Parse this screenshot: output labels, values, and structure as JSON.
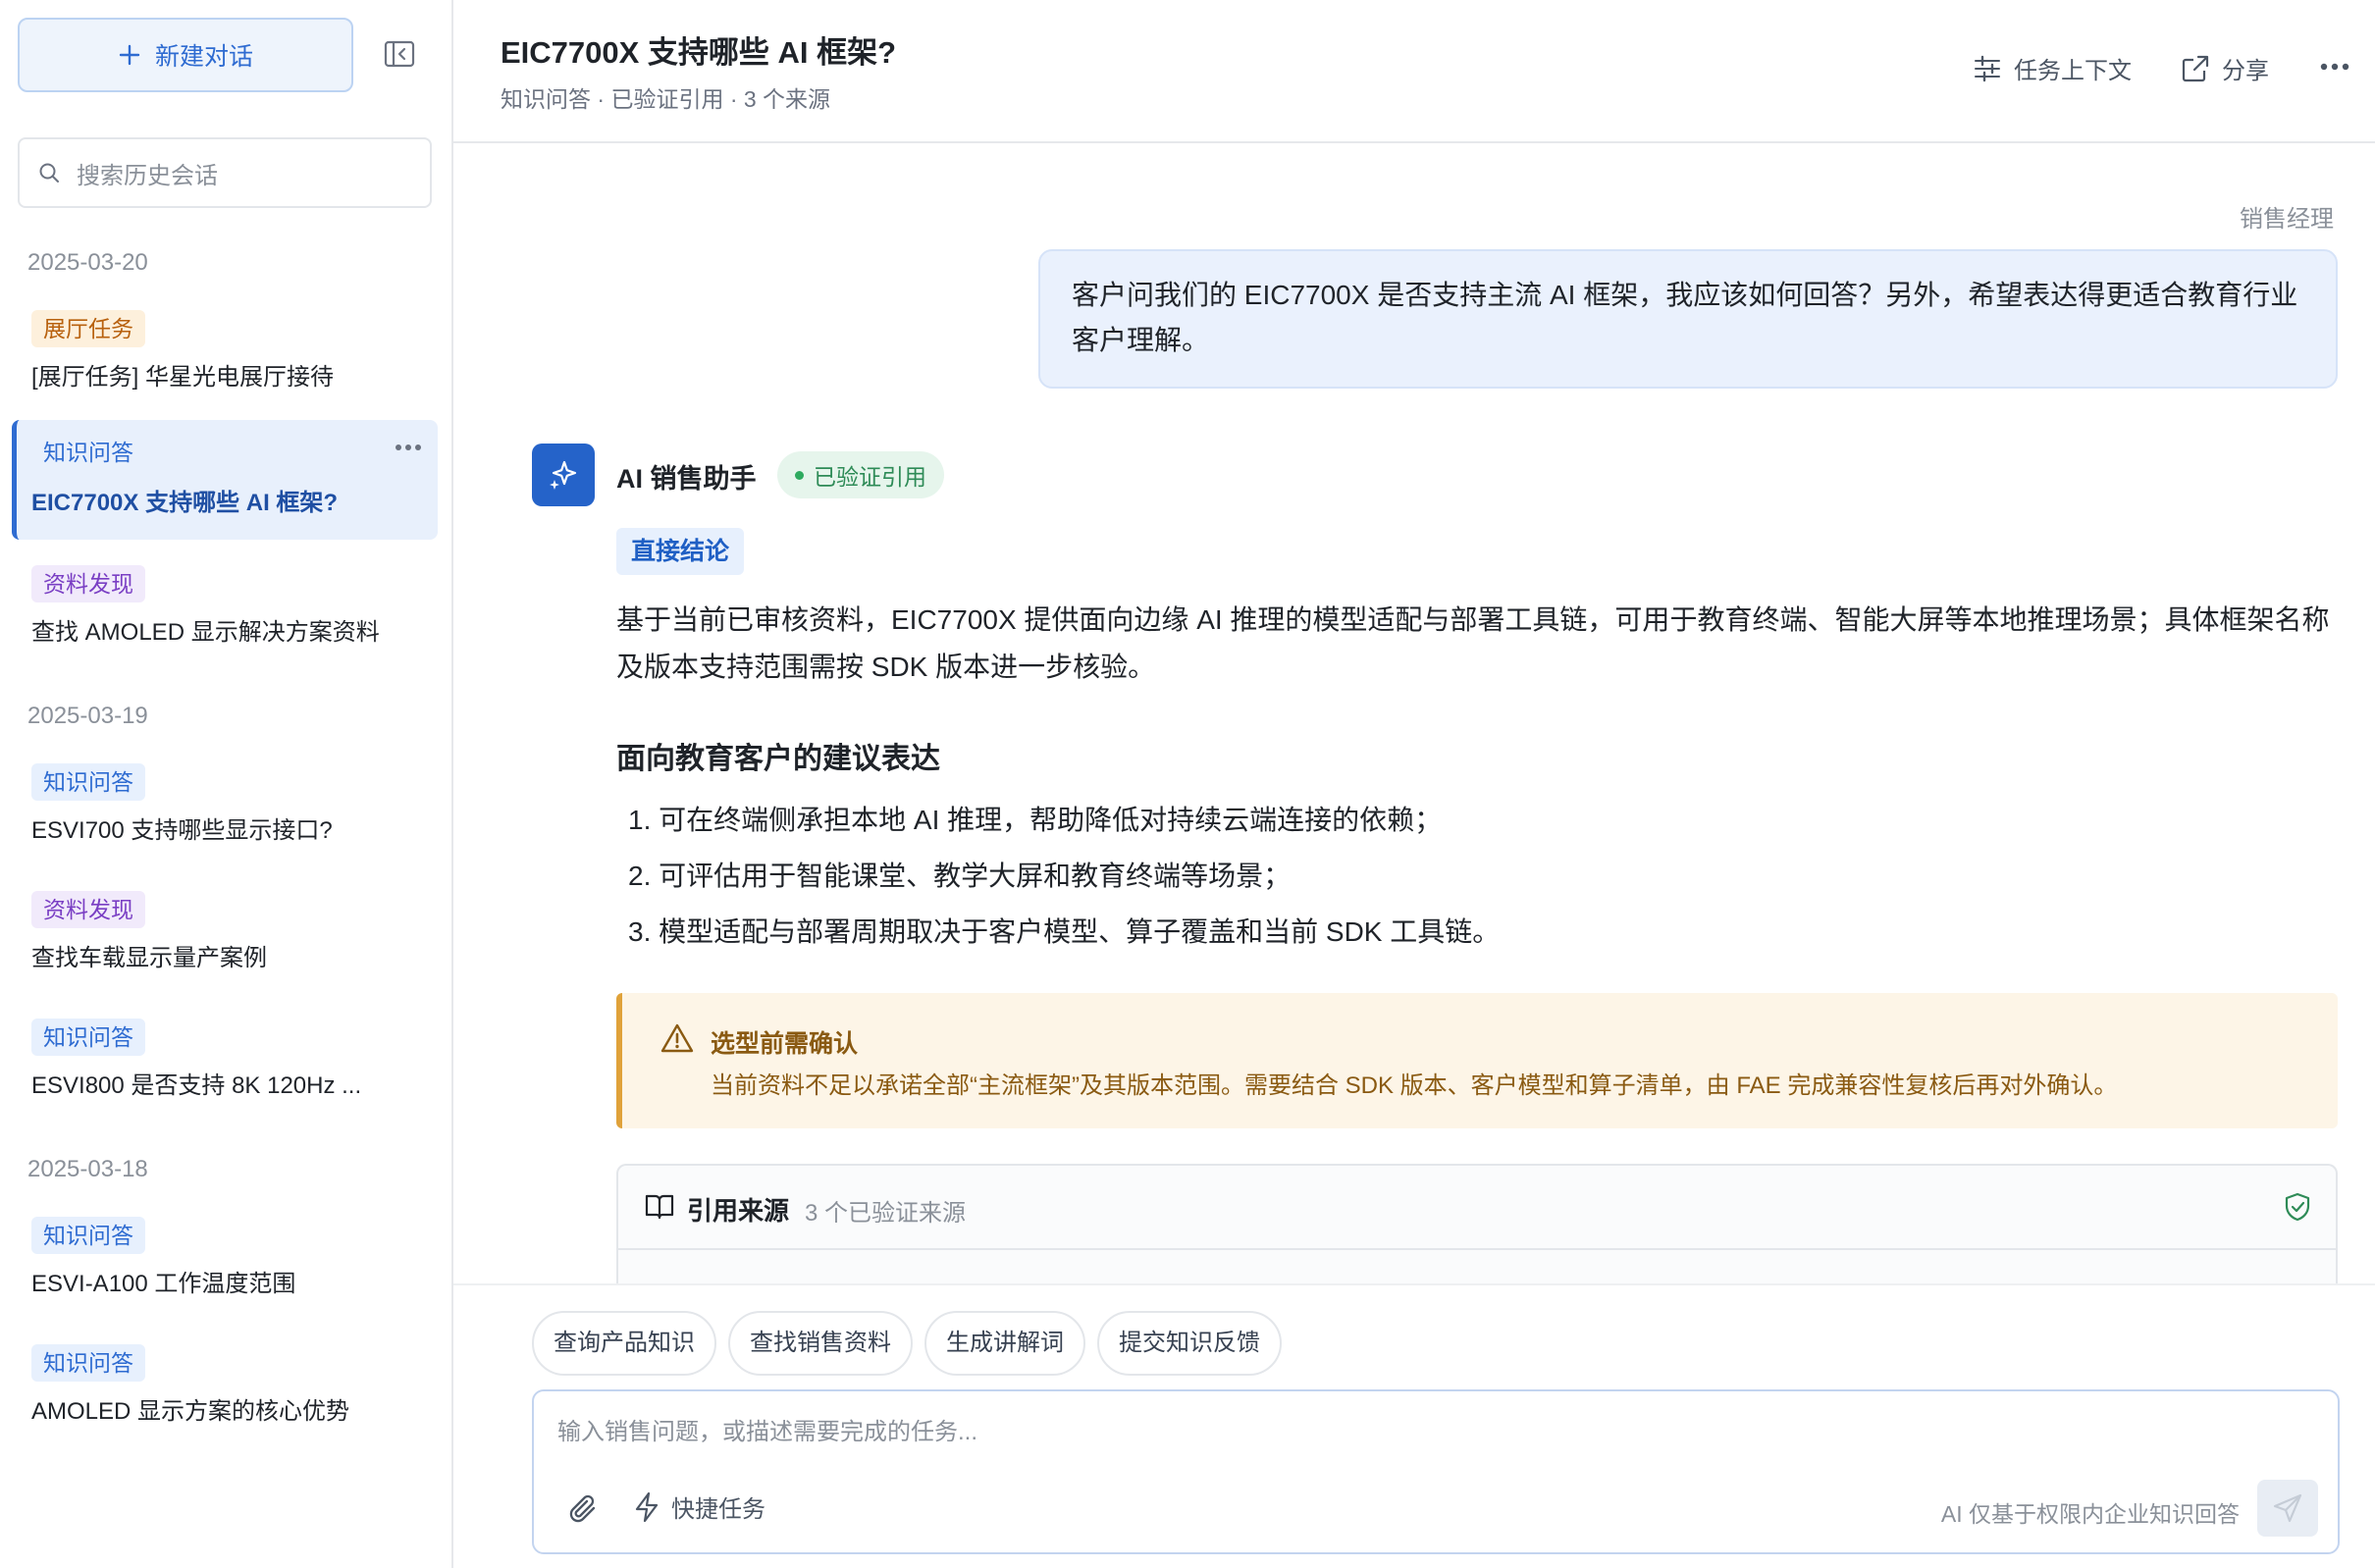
{
  "sidebar": {
    "new_chat_label": "新建对话",
    "search_placeholder": "搜索历史会话",
    "groups": [
      {
        "date": "2025-03-20",
        "items": [
          {
            "tag": "展厅任务",
            "title": "[展厅任务] 华星光电展厅接待"
          },
          {
            "tag": "知识问答",
            "title": "EIC7700X 支持哪些 AI 框架?"
          },
          {
            "tag": "资料发现",
            "title": "查找 AMOLED 显示解决方案资料"
          }
        ]
      },
      {
        "date": "2025-03-19",
        "items": [
          {
            "tag": "知识问答",
            "title": "ESVI700 支持哪些显示接口?"
          },
          {
            "tag": "资料发现",
            "title": "查找车载显示量产案例"
          },
          {
            "tag": "知识问答",
            "title": "ESVI800 是否支持 8K 120Hz ..."
          }
        ]
      },
      {
        "date": "2025-03-18",
        "items": [
          {
            "tag": "知识问答",
            "title": "ESVI-A100 工作温度范围"
          },
          {
            "tag": "知识问答",
            "title": "AMOLED 显示方案的核心优势"
          }
        ]
      }
    ]
  },
  "header": {
    "title": "EIC7700X 支持哪些 AI 框架?",
    "subtitle": "知识问答 · 已验证引用 · 3 个来源",
    "context_label": "任务上下文",
    "share_label": "分享"
  },
  "chat": {
    "user_role": "销售经理",
    "user_message": "客户问我们的 EIC7700X 是否支持主流 AI 框架，我应该如何回答？另外，希望表达得更适合教育行业客户理解。",
    "assistant_name": "AI 销售助手",
    "verified_label": "已验证引用",
    "conclusion_tag": "直接结论",
    "conclusion_text": "基于当前已审核资料，EIC7700X 提供面向边缘 AI 推理的模型适配与部署工具链，可用于教育终端、智能大屏等本地推理场景；具体框架名称及版本支持范围需按 SDK 版本进一步核验。",
    "section_heading": "面向教育客户的建议表达",
    "list": [
      "1. 可在终端侧承担本地 AI 推理，帮助降低对持续云端连接的依赖；",
      "2. 可评估用于智能课堂、教学大屏和教育终端等场景；",
      "3. 模型适配与部署周期取决于客户模型、算子覆盖和当前 SDK 工具链。"
    ],
    "warning_title": "选型前需确认",
    "warning_text": "当前资料不足以承诺全部“主流框架”及其版本范围。需要结合 SDK 版本、客户模型和算子清单，由 FAE 完成兼容性复核后再对外确认。",
    "sources_title": "引用来源",
    "sources_count": "3 个已验证来源"
  },
  "input": {
    "chips": [
      "查询产品知识",
      "查找销售资料",
      "生成讲解词",
      "提交知识反馈"
    ],
    "placeholder": "输入销售问题，或描述需要完成的任务...",
    "quick_task_label": "快捷任务",
    "hint": "AI 仅基于权限内企业知识回答"
  },
  "colors": {
    "accent": "#2e6bd1",
    "verified_green": "#2e8b57",
    "warning_border": "#e0a23a"
  }
}
